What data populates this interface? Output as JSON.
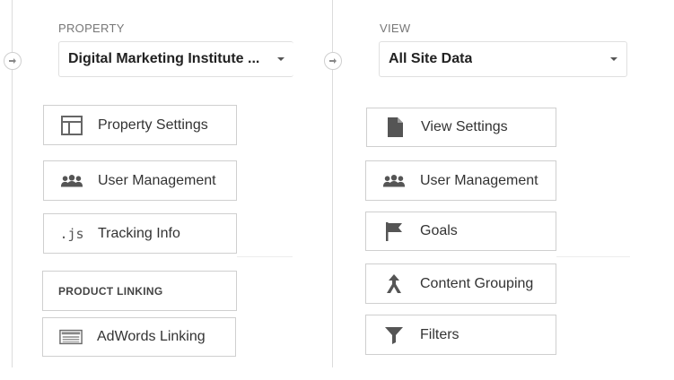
{
  "property": {
    "label": "PROPERTY",
    "selected": "Digital Marketing Institute ...",
    "items": [
      {
        "label": "Property Settings",
        "icon": "layout-icon"
      },
      {
        "label": "User Management",
        "icon": "users-icon"
      },
      {
        "label": "Tracking Info",
        "icon": "js-icon"
      }
    ],
    "product_linking": {
      "heading": "PRODUCT LINKING",
      "items": [
        {
          "label": "AdWords Linking",
          "icon": "adwords-icon"
        }
      ]
    }
  },
  "view": {
    "label": "VIEW",
    "selected": "All Site Data",
    "items": [
      {
        "label": "View Settings",
        "icon": "document-icon"
      },
      {
        "label": "User Management",
        "icon": "users-icon"
      },
      {
        "label": "Goals",
        "icon": "flag-icon"
      },
      {
        "label": "Content Grouping",
        "icon": "content-grouping-icon"
      },
      {
        "label": "Filters",
        "icon": "filter-icon"
      }
    ]
  },
  "icons": {
    "js_text": ".js"
  },
  "colors": {
    "icon": "#555555",
    "border": "#cfcfcf",
    "label": "#777777"
  }
}
